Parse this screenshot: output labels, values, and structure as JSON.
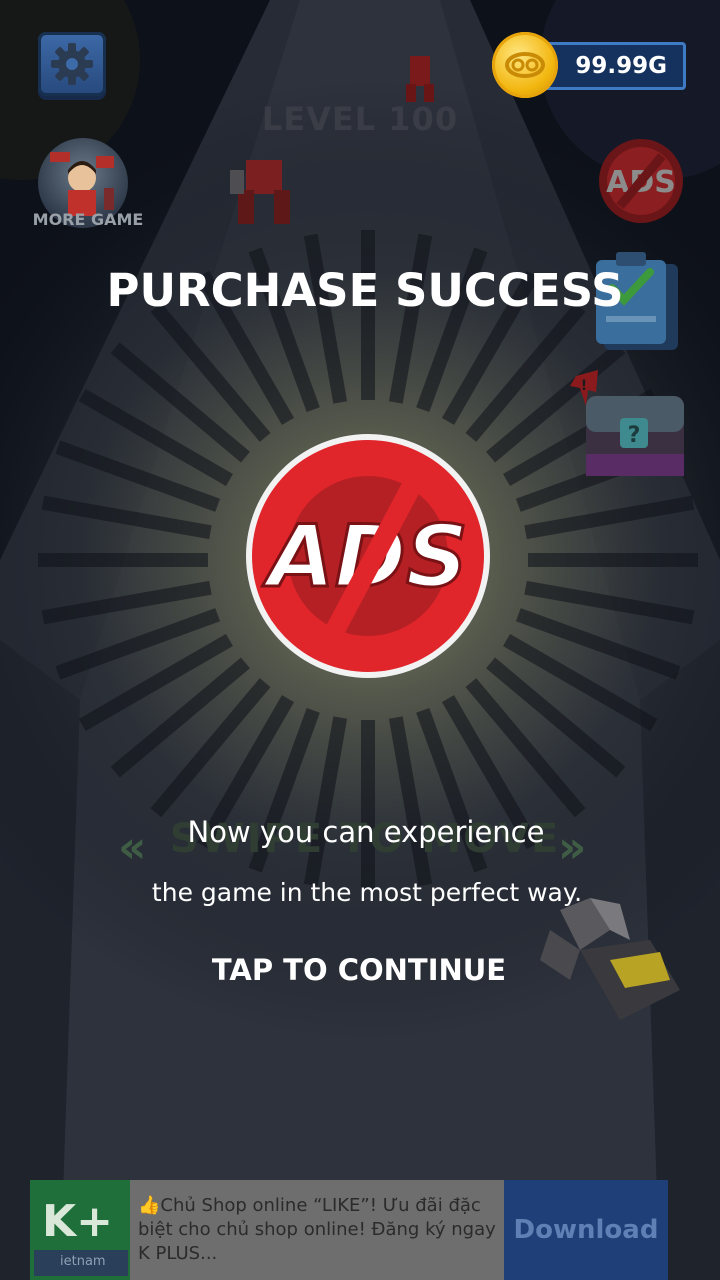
{
  "hud": {
    "coins": "99.99G",
    "level": "LEVEL 100",
    "more_game_label": "MORE GAME"
  },
  "dialog": {
    "title": "PURCHASE SUCCESS",
    "badge_text": "ADS",
    "message_line1": "Now you can experience",
    "message_line2": "the game in the most perfect way.",
    "continue_label": "TAP TO CONTINUE"
  },
  "background_hint": {
    "text": "SWIPE TO MOVE",
    "arrow_left": "«",
    "arrow_right": "»"
  },
  "ad": {
    "logo_text": "K+",
    "logo_sub": "ietnam",
    "text": "👍Chủ Shop online “LIKE”! Ưu đãi đặc biệt cho chủ shop online! Đăng ký ngay K PLUS...",
    "download_label": "Download"
  },
  "icons": {
    "settings": "gear-icon",
    "coin": "coin-icon",
    "no_ads": "no-ads-icon",
    "clipboard": "clipboard-check-icon",
    "chest": "mystery-chest-icon"
  },
  "colors": {
    "background": "#0c0f18",
    "glow": "#e6e6b0",
    "no_ads_red": "#e0252b",
    "coin_gold": "#f2b60f",
    "hud_blue": "#3f7bc4",
    "ad_download": "#1e3f78"
  }
}
